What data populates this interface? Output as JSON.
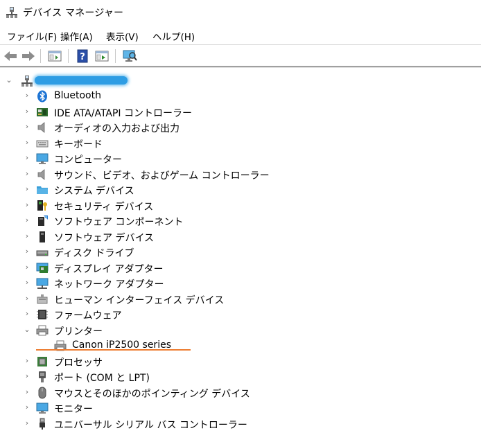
{
  "window": {
    "title": "デバイス マネージャー"
  },
  "menu": {
    "file": "ファイル(F)",
    "action": "操作(A)",
    "view": "表示(V)",
    "help": "ヘルプ(H)"
  },
  "toolbar": {
    "buttons": [
      "back-icon",
      "forward-icon",
      "properties-icon",
      "help-icon",
      "run-icon",
      "monitor-scan-icon"
    ]
  },
  "tree": {
    "root_name_redacted": true,
    "categories": [
      {
        "label": "Bluetooth",
        "icon": "bluetooth-icon",
        "expanded": false
      },
      {
        "label": "IDE ATA/ATAPI コントローラー",
        "icon": "ide-controller-icon",
        "expanded": false
      },
      {
        "label": "オーディオの入力および出力",
        "icon": "speaker-icon",
        "expanded": false
      },
      {
        "label": "キーボード",
        "icon": "keyboard-icon",
        "expanded": false
      },
      {
        "label": "コンピューター",
        "icon": "computer-icon",
        "expanded": false
      },
      {
        "label": "サウンド、ビデオ、およびゲーム コントローラー",
        "icon": "speaker-icon",
        "expanded": false
      },
      {
        "label": "システム デバイス",
        "icon": "folder-icon",
        "expanded": false
      },
      {
        "label": "セキュリティ デバイス",
        "icon": "security-key-icon",
        "expanded": false
      },
      {
        "label": "ソフトウェア コンポーネント",
        "icon": "software-component-icon",
        "expanded": false
      },
      {
        "label": "ソフトウェア デバイス",
        "icon": "software-device-icon",
        "expanded": false
      },
      {
        "label": "ディスク ドライブ",
        "icon": "disk-drive-icon",
        "expanded": false
      },
      {
        "label": "ディスプレイ アダプター",
        "icon": "display-adapter-icon",
        "expanded": false
      },
      {
        "label": "ネットワーク アダプター",
        "icon": "network-adapter-icon",
        "expanded": false
      },
      {
        "label": "ヒューマン インターフェイス デバイス",
        "icon": "hid-icon",
        "expanded": false
      },
      {
        "label": "ファームウェア",
        "icon": "firmware-icon",
        "expanded": false
      },
      {
        "label": "プリンター",
        "icon": "printer-icon",
        "expanded": true,
        "children": [
          {
            "label": "Canon iP2500 series",
            "icon": "printer-icon"
          }
        ]
      },
      {
        "label": "プロセッサ",
        "icon": "processor-icon",
        "expanded": false
      },
      {
        "label": "ポート (COM と LPT)",
        "icon": "port-icon",
        "expanded": false
      },
      {
        "label": "マウスとそのほかのポインティング デバイス",
        "icon": "mouse-icon",
        "expanded": false
      },
      {
        "label": "モニター",
        "icon": "monitor-icon",
        "expanded": false
      },
      {
        "label": "ユニバーサル シリアル バス コントローラー",
        "icon": "usb-icon",
        "expanded": false
      }
    ]
  },
  "colors": {
    "highlight_underline": "#ed7d31",
    "redaction_blue": "#2e9de4"
  }
}
